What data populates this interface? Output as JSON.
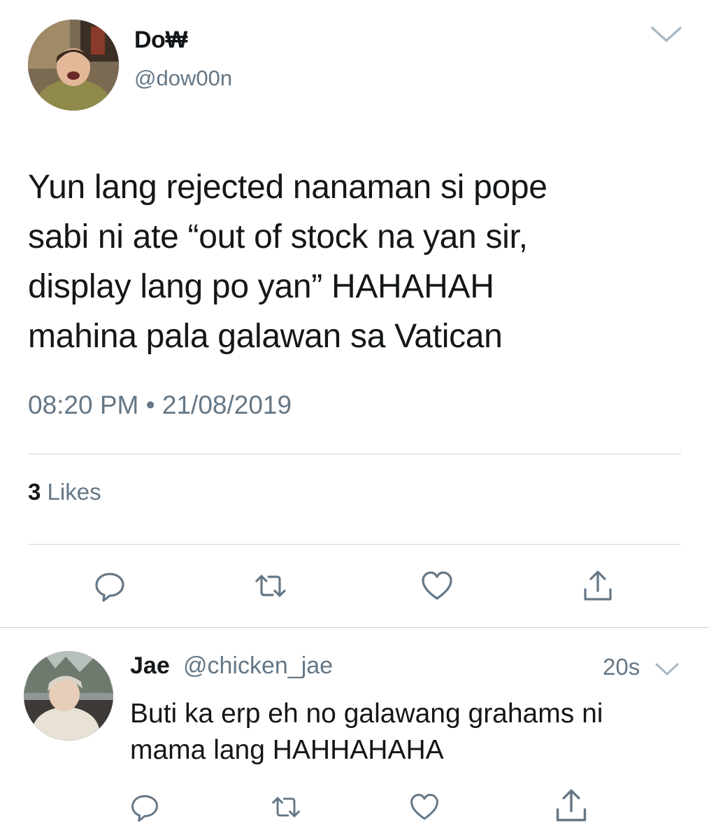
{
  "tweet": {
    "author_name": "Do₩",
    "author_handle": "@dow00n",
    "text_lines": [
      "Yun lang rejected nanaman si pope",
      "sabi ni ate “out of stock na yan sir,",
      "display lang po yan” HAHAHAH",
      "mahina pala galawan sa Vatican"
    ],
    "timestamp": "08:20 PM • 21/08/2019",
    "likes_count": "3",
    "likes_label": "Likes"
  },
  "reply": {
    "author_name": "Jae",
    "author_handle": "@chicken_jae",
    "time_ago": "20s",
    "text_lines": [
      "Buti ka erp eh no galawang grahams ni",
      "mama lang HAHHAHAHA"
    ]
  },
  "icons": {
    "reply": "comment-bubble-icon",
    "retweet": "retweet-arrows-icon",
    "like": "heart-outline-icon",
    "share": "share-upload-icon",
    "more": "chevron-down-icon"
  },
  "colors": {
    "text_primary": "#14171a",
    "text_secondary": "#657786",
    "divider": "#ccd6dd",
    "background": "#ffffff"
  }
}
